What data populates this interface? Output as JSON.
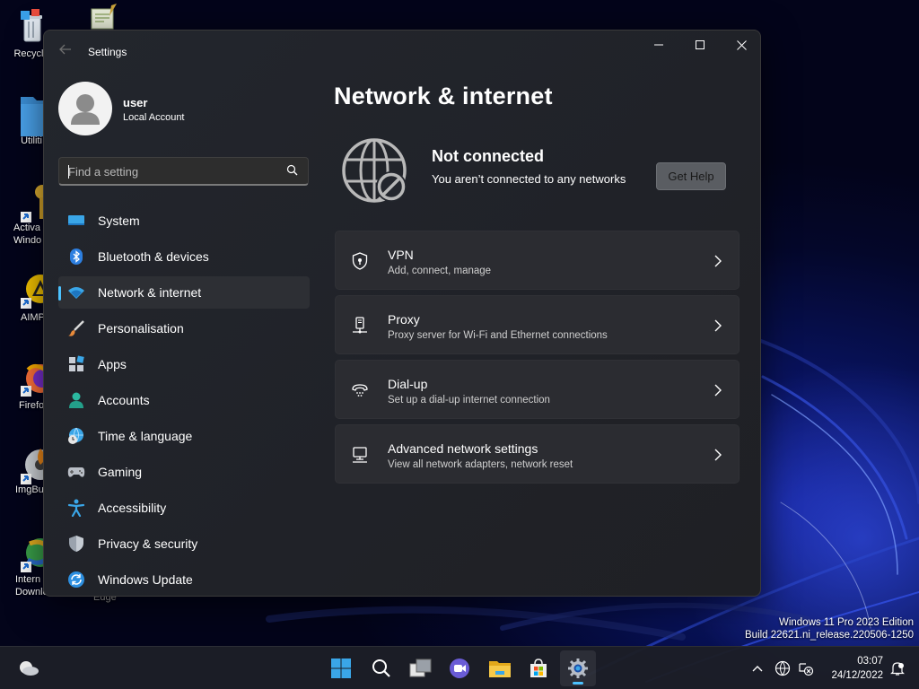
{
  "desktop": {
    "icons": [
      {
        "label": "Recycle"
      },
      {
        "label": "Utiliti"
      },
      {
        "label": "Activa\nWindo"
      },
      {
        "label": "AIMP"
      },
      {
        "label": "Firefo"
      },
      {
        "label": "ImgBu"
      },
      {
        "label": "Intern\nDownlo..."
      }
    ],
    "partial_label": "Edge"
  },
  "window": {
    "title": "Settings",
    "back_icon": "arrow-left-icon",
    "controls": [
      "minimize",
      "maximize",
      "close"
    ]
  },
  "profile": {
    "name": "user",
    "account_type": "Local Account"
  },
  "search": {
    "placeholder": "Find a setting"
  },
  "nav": {
    "items": [
      {
        "label": "System",
        "icon": "monitor-icon",
        "active": false
      },
      {
        "label": "Bluetooth & devices",
        "icon": "bluetooth-icon",
        "active": false
      },
      {
        "label": "Network & internet",
        "icon": "wifi-icon",
        "active": true
      },
      {
        "label": "Personalisation",
        "icon": "brush-icon",
        "active": false
      },
      {
        "label": "Apps",
        "icon": "apps-icon",
        "active": false
      },
      {
        "label": "Accounts",
        "icon": "person-icon",
        "active": false
      },
      {
        "label": "Time & language",
        "icon": "globe-clock-icon",
        "active": false
      },
      {
        "label": "Gaming",
        "icon": "gamepad-icon",
        "active": false
      },
      {
        "label": "Accessibility",
        "icon": "accessibility-icon",
        "active": false
      },
      {
        "label": "Privacy & security",
        "icon": "shield-icon",
        "active": false
      },
      {
        "label": "Windows Update",
        "icon": "update-icon",
        "active": false
      }
    ]
  },
  "main": {
    "title": "Network & internet",
    "status": {
      "title": "Not connected",
      "subtitle": "You aren’t connected to any networks",
      "help_button": "Get Help"
    },
    "cards": [
      {
        "title": "VPN",
        "subtitle": "Add, connect, manage",
        "icon": "vpn-shield-icon"
      },
      {
        "title": "Proxy",
        "subtitle": "Proxy server for Wi-Fi and Ethernet connections",
        "icon": "proxy-icon"
      },
      {
        "title": "Dial-up",
        "subtitle": "Set up a dial-up internet connection",
        "icon": "dialup-icon"
      },
      {
        "title": "Advanced network settings",
        "subtitle": "View all network adapters, network reset",
        "icon": "network-adapter-icon"
      }
    ]
  },
  "watermark": {
    "line1": "Windows 11 Pro 2023 Edition",
    "line2": "Build 22621.ni_release.220506-1250"
  },
  "taskbar": {
    "apps": [
      "start-icon",
      "search-icon",
      "task-view-icon",
      "chat-icon",
      "file-explorer-icon",
      "store-icon",
      "settings-icon"
    ],
    "time": "03:07",
    "date": "24/12/2022"
  },
  "colors": {
    "accent": "#4cc2ff",
    "window_bg": "#202228",
    "card_bg": "#2b2c31"
  }
}
